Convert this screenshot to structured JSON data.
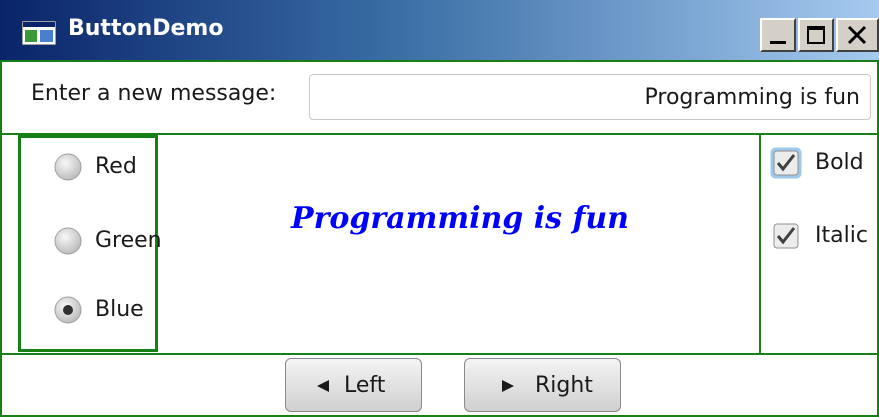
{
  "window": {
    "title": "ButtonDemo",
    "icons": {
      "app": "app-window-icon",
      "minimize": "minimize-icon",
      "maximize": "maximize-icon",
      "close": "close-icon"
    }
  },
  "message": {
    "label": "Enter a new message:",
    "value": "Programming is fun"
  },
  "display": {
    "text": "Programming is fun",
    "color": "#0000ff"
  },
  "colors": {
    "items": [
      {
        "label": "Red",
        "selected": false
      },
      {
        "label": "Green",
        "selected": false
      },
      {
        "label": "Blue",
        "selected": true
      }
    ]
  },
  "styles": {
    "items": [
      {
        "label": "Bold",
        "checked": true,
        "focused": true
      },
      {
        "label": "Italic",
        "checked": true,
        "focused": false
      }
    ]
  },
  "buttons": {
    "left": "Left",
    "right": "Right",
    "icons": {
      "left": "left-arrow-icon",
      "right": "right-arrow-icon"
    }
  },
  "theme": {
    "border": "#168016",
    "title_start": "#0a246a",
    "title_end": "#a6caf0"
  }
}
